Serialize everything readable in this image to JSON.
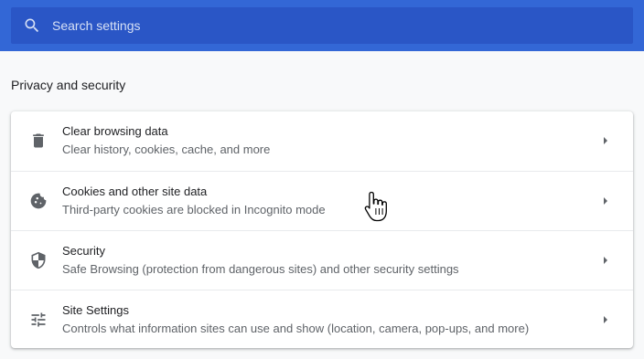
{
  "search": {
    "placeholder": "Search settings"
  },
  "section": {
    "title": "Privacy and security"
  },
  "items": [
    {
      "title": "Clear browsing data",
      "subtitle": "Clear history, cookies, cache, and more",
      "icon": "trash-icon"
    },
    {
      "title": "Cookies and other site data",
      "subtitle": "Third-party cookies are blocked in Incognito mode",
      "icon": "cookie-icon"
    },
    {
      "title": "Security",
      "subtitle": "Safe Browsing (protection from dangerous sites) and other security settings",
      "icon": "shield-icon"
    },
    {
      "title": "Site Settings",
      "subtitle": "Controls what information sites can use and show (location, camera, pop-ups, and more)",
      "icon": "tune-icon"
    }
  ],
  "colors": {
    "header": "#3367d6",
    "search_bg": "#2a56c6",
    "background": "#f8f9fa"
  }
}
